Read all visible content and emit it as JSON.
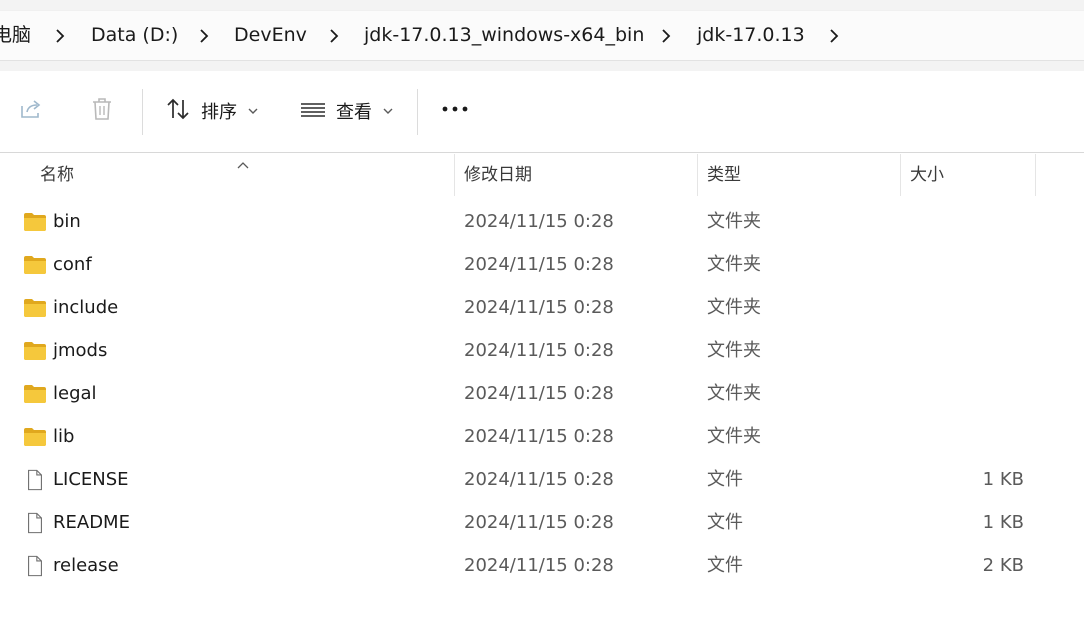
{
  "breadcrumb": {
    "items": [
      "电脑",
      "Data (D:)",
      "DevEnv",
      "jdk-17.0.13_windows-x64_bin",
      "jdk-17.0.13"
    ]
  },
  "toolbar": {
    "share_icon": "share-icon",
    "delete_icon": "trash-icon",
    "sort_label": "排序",
    "view_label": "查看",
    "more_label": "•••"
  },
  "columns": {
    "name": "名称",
    "date": "修改日期",
    "type": "类型",
    "size": "大小"
  },
  "files": [
    {
      "name": "bin",
      "date": "2024/11/15 0:28",
      "type": "文件夹",
      "size": "",
      "icon": "folder-icon"
    },
    {
      "name": "conf",
      "date": "2024/11/15 0:28",
      "type": "文件夹",
      "size": "",
      "icon": "folder-icon"
    },
    {
      "name": "include",
      "date": "2024/11/15 0:28",
      "type": "文件夹",
      "size": "",
      "icon": "folder-icon"
    },
    {
      "name": "jmods",
      "date": "2024/11/15 0:28",
      "type": "文件夹",
      "size": "",
      "icon": "folder-icon"
    },
    {
      "name": "legal",
      "date": "2024/11/15 0:28",
      "type": "文件夹",
      "size": "",
      "icon": "folder-icon"
    },
    {
      "name": "lib",
      "date": "2024/11/15 0:28",
      "type": "文件夹",
      "size": "",
      "icon": "folder-icon"
    },
    {
      "name": "LICENSE",
      "date": "2024/11/15 0:28",
      "type": "文件",
      "size": "1 KB",
      "icon": "file-icon"
    },
    {
      "name": "README",
      "date": "2024/11/15 0:28",
      "type": "文件",
      "size": "1 KB",
      "icon": "file-icon"
    },
    {
      "name": "release",
      "date": "2024/11/15 0:28",
      "type": "文件",
      "size": "2 KB",
      "icon": "file-icon"
    }
  ],
  "colors": {
    "folder": "#f5c83c",
    "folder_dark": "#e0a81e",
    "text": "#1a1a1a",
    "muted": "#5a5a5a",
    "icon_disabled": "#b9b9b9"
  }
}
